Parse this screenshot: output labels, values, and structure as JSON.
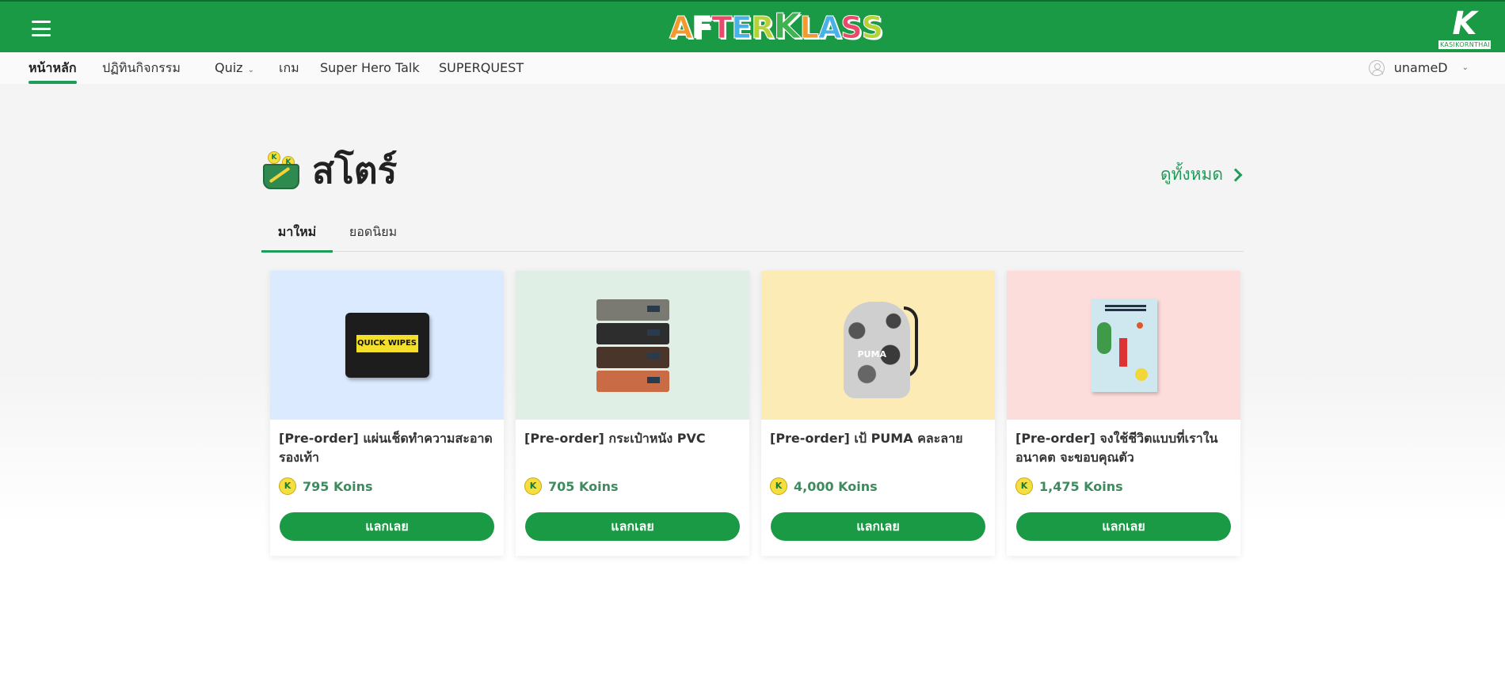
{
  "topbar": {
    "brand_logo": "AFTERKLASS",
    "bank_logo_letter": "K",
    "bank_logo_name": "KASIKORNTHAI",
    "color": "#1a9a44"
  },
  "nav": {
    "items": [
      {
        "label": "หน้าหลัก",
        "active": true
      },
      {
        "label": "ปฏิทินกิจกรรม"
      },
      {
        "label": "Quiz",
        "has_dropdown": true
      },
      {
        "label": "เกม"
      },
      {
        "label": "Super Hero Talk"
      },
      {
        "label": "SUPERQUEST"
      }
    ],
    "user": {
      "name": "unameD"
    }
  },
  "store": {
    "title": "สโตร์",
    "see_all": "ดูทั้งหมด",
    "tabs": [
      {
        "label": "มาใหม่",
        "active": true
      },
      {
        "label": "ยอดนิยม"
      }
    ],
    "products": [
      {
        "title": "[Pre-order] แผ่นเช็ดทำความสะอาดรองเท้า",
        "price": "795 Koins",
        "button": "แลกเลย",
        "bg": "#dbeafe",
        "image_label": "QUICK WIPES"
      },
      {
        "title": "[Pre-order] กระเป๋าหนัง PVC",
        "price": "705 Koins",
        "button": "แลกเลย",
        "bg": "#e0efe6"
      },
      {
        "title": "[Pre-order] เป้ PUMA คละลาย",
        "price": "4,000 Koins",
        "button": "แลกเลย",
        "bg": "#fdebb6",
        "image_label": "PUMA"
      },
      {
        "title": "[Pre-order] จงใช้ชีวิตแบบที่เราในอนาคต จะขอบคุณตัว",
        "price": "1,475 Koins",
        "button": "แลกเลย",
        "bg": "#fddcdc"
      }
    ]
  },
  "koin_icon_letter": "K"
}
